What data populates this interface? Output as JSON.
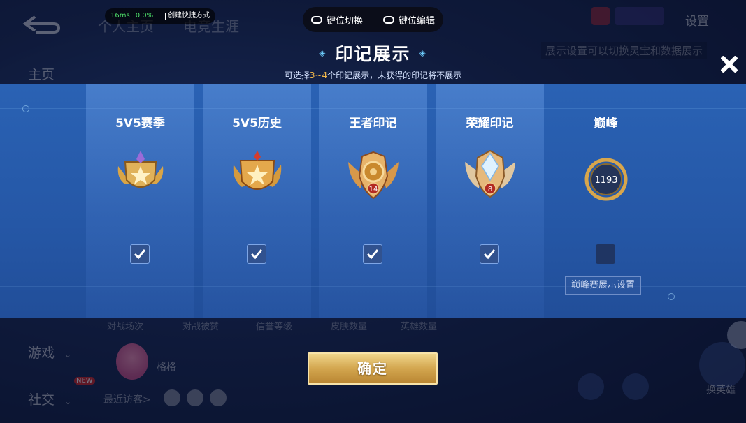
{
  "perf": {
    "ping": "16ms",
    "loss": "0.0%",
    "shortcut_label": "创建快捷方式"
  },
  "keybar": {
    "switch_label": "键位切换",
    "edit_label": "键位编辑"
  },
  "background": {
    "tabs": [
      "个人主页",
      "电竞生涯"
    ],
    "side": [
      "主页",
      "游戏",
      "社交"
    ],
    "settings": "设置",
    "notice": "展示设置可以切换灵宝和数据展示",
    "stats": [
      "对战场次",
      "对战被赞",
      "信誉等级",
      "皮肤数量",
      "英雄数量"
    ],
    "user_name": "格格",
    "recent_visitors": "最近访客>",
    "new_badge": "NEW",
    "switch_hero": "换英雄"
  },
  "modal": {
    "title": "印记展示",
    "subtitle_prefix": "可选择",
    "subtitle_range": "3~4",
    "subtitle_suffix": "个印记展示，未获得的印记将不展示",
    "marks": [
      {
        "label": "5V5赛季",
        "checked": true,
        "badge": "silver-star-badge"
      },
      {
        "label": "5V5历史",
        "checked": true,
        "badge": "gold-star-badge"
      },
      {
        "label": "王者印记",
        "checked": true,
        "badge": "king-mark-badge",
        "number": "14"
      },
      {
        "label": "荣耀印记",
        "checked": true,
        "badge": "glory-mark-badge",
        "number": "8"
      },
      {
        "label": "巅峰",
        "checked": false,
        "badge": "peak-badge",
        "number": "1193"
      }
    ],
    "peak_setting": "巅峰赛展示设置",
    "confirm": "确定"
  },
  "colors": {
    "band": "#2557a6",
    "accent": "#f4b84a",
    "confirm_gold": "#d3a64f"
  }
}
